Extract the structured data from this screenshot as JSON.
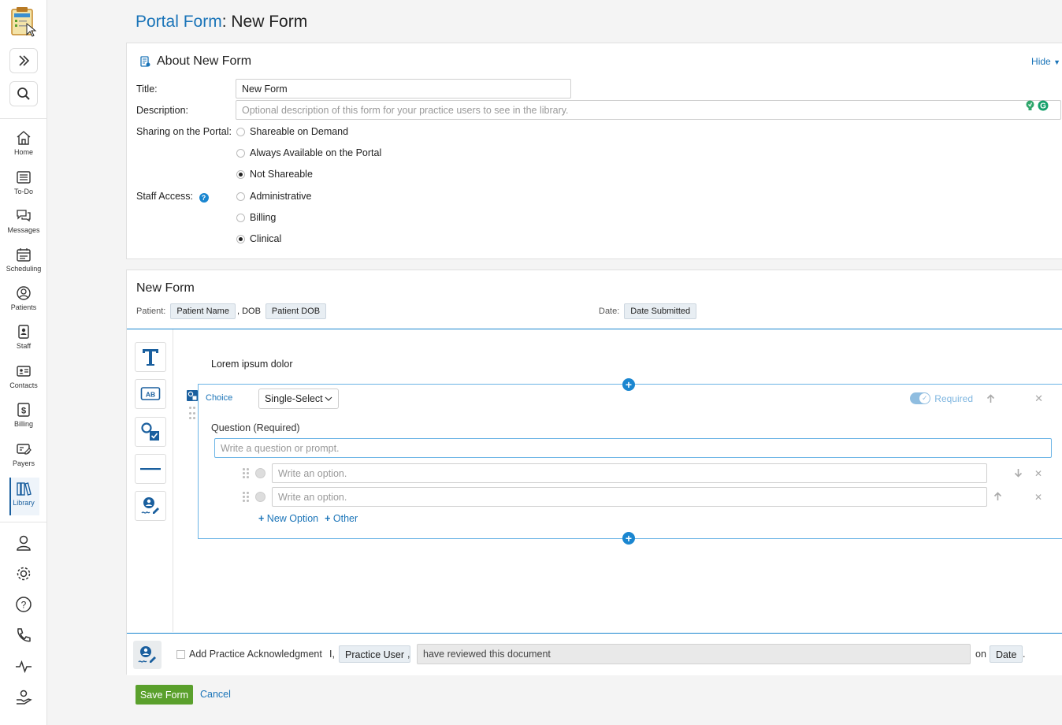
{
  "page": {
    "title_prefix": "Portal Form",
    "title_suffix": ": New Form"
  },
  "nav": {
    "items": [
      {
        "label": "Home",
        "icon": "home-icon"
      },
      {
        "label": "To-Do",
        "icon": "list-icon"
      },
      {
        "label": "Messages",
        "icon": "chat-icon"
      },
      {
        "label": "Scheduling",
        "icon": "calendar-icon"
      },
      {
        "label": "Patients",
        "icon": "user-circle-icon"
      },
      {
        "label": "Staff",
        "icon": "badge-icon"
      },
      {
        "label": "Contacts",
        "icon": "contact-card-icon"
      },
      {
        "label": "Billing",
        "icon": "dollar-icon"
      },
      {
        "label": "Payers",
        "icon": "payer-card-icon"
      },
      {
        "label": "Library",
        "icon": "books-icon",
        "active": true
      }
    ]
  },
  "about": {
    "heading": "About New Form",
    "hide_label": "Hide",
    "title_label": "Title:",
    "title_value": "New Form",
    "description_label": "Description:",
    "description_placeholder": "Optional description of this form for your practice users to see in the library.",
    "sharing_label": "Sharing on the Portal:",
    "sharing_options": [
      {
        "label": "Shareable on Demand",
        "selected": false
      },
      {
        "label": "Always Available on the Portal",
        "selected": false
      },
      {
        "label": "Not Shareable",
        "selected": true
      }
    ],
    "staff_label": "Staff Access:",
    "staff_options": [
      {
        "label": "Administrative",
        "selected": false
      },
      {
        "label": "Billing",
        "selected": false
      },
      {
        "label": "Clinical",
        "selected": true
      }
    ]
  },
  "form": {
    "title": "New Form",
    "patient_label": "Patient:",
    "patient_chip": "Patient Name",
    "dob_label": ", DOB",
    "dob_chip": "Patient DOB",
    "date_label": "Date:",
    "date_chip": "Date Submitted",
    "intro_text": "Lorem ipsum dolor",
    "question": {
      "type_label": "Choice",
      "select_value": "Single-Select",
      "required_label": "Required",
      "question_label": "Question (Required)",
      "question_placeholder": "Write a question or prompt.",
      "options": [
        {
          "placeholder": "Write an option."
        },
        {
          "placeholder": "Write an option."
        }
      ],
      "new_option_label": "New Option",
      "other_label": "Other"
    }
  },
  "ack": {
    "label": "Add Practice Acknowledgment",
    "prefix": "I,",
    "user_chip": "Practice User",
    "comma": ",",
    "statement": "have reviewed this document",
    "on_label": "on",
    "date_chip": "Date",
    "period": "."
  },
  "actions": {
    "save_label": "Save Form",
    "cancel_label": "Cancel"
  },
  "colors": {
    "accent": "#1a74b8",
    "save": "#5aa02c"
  }
}
